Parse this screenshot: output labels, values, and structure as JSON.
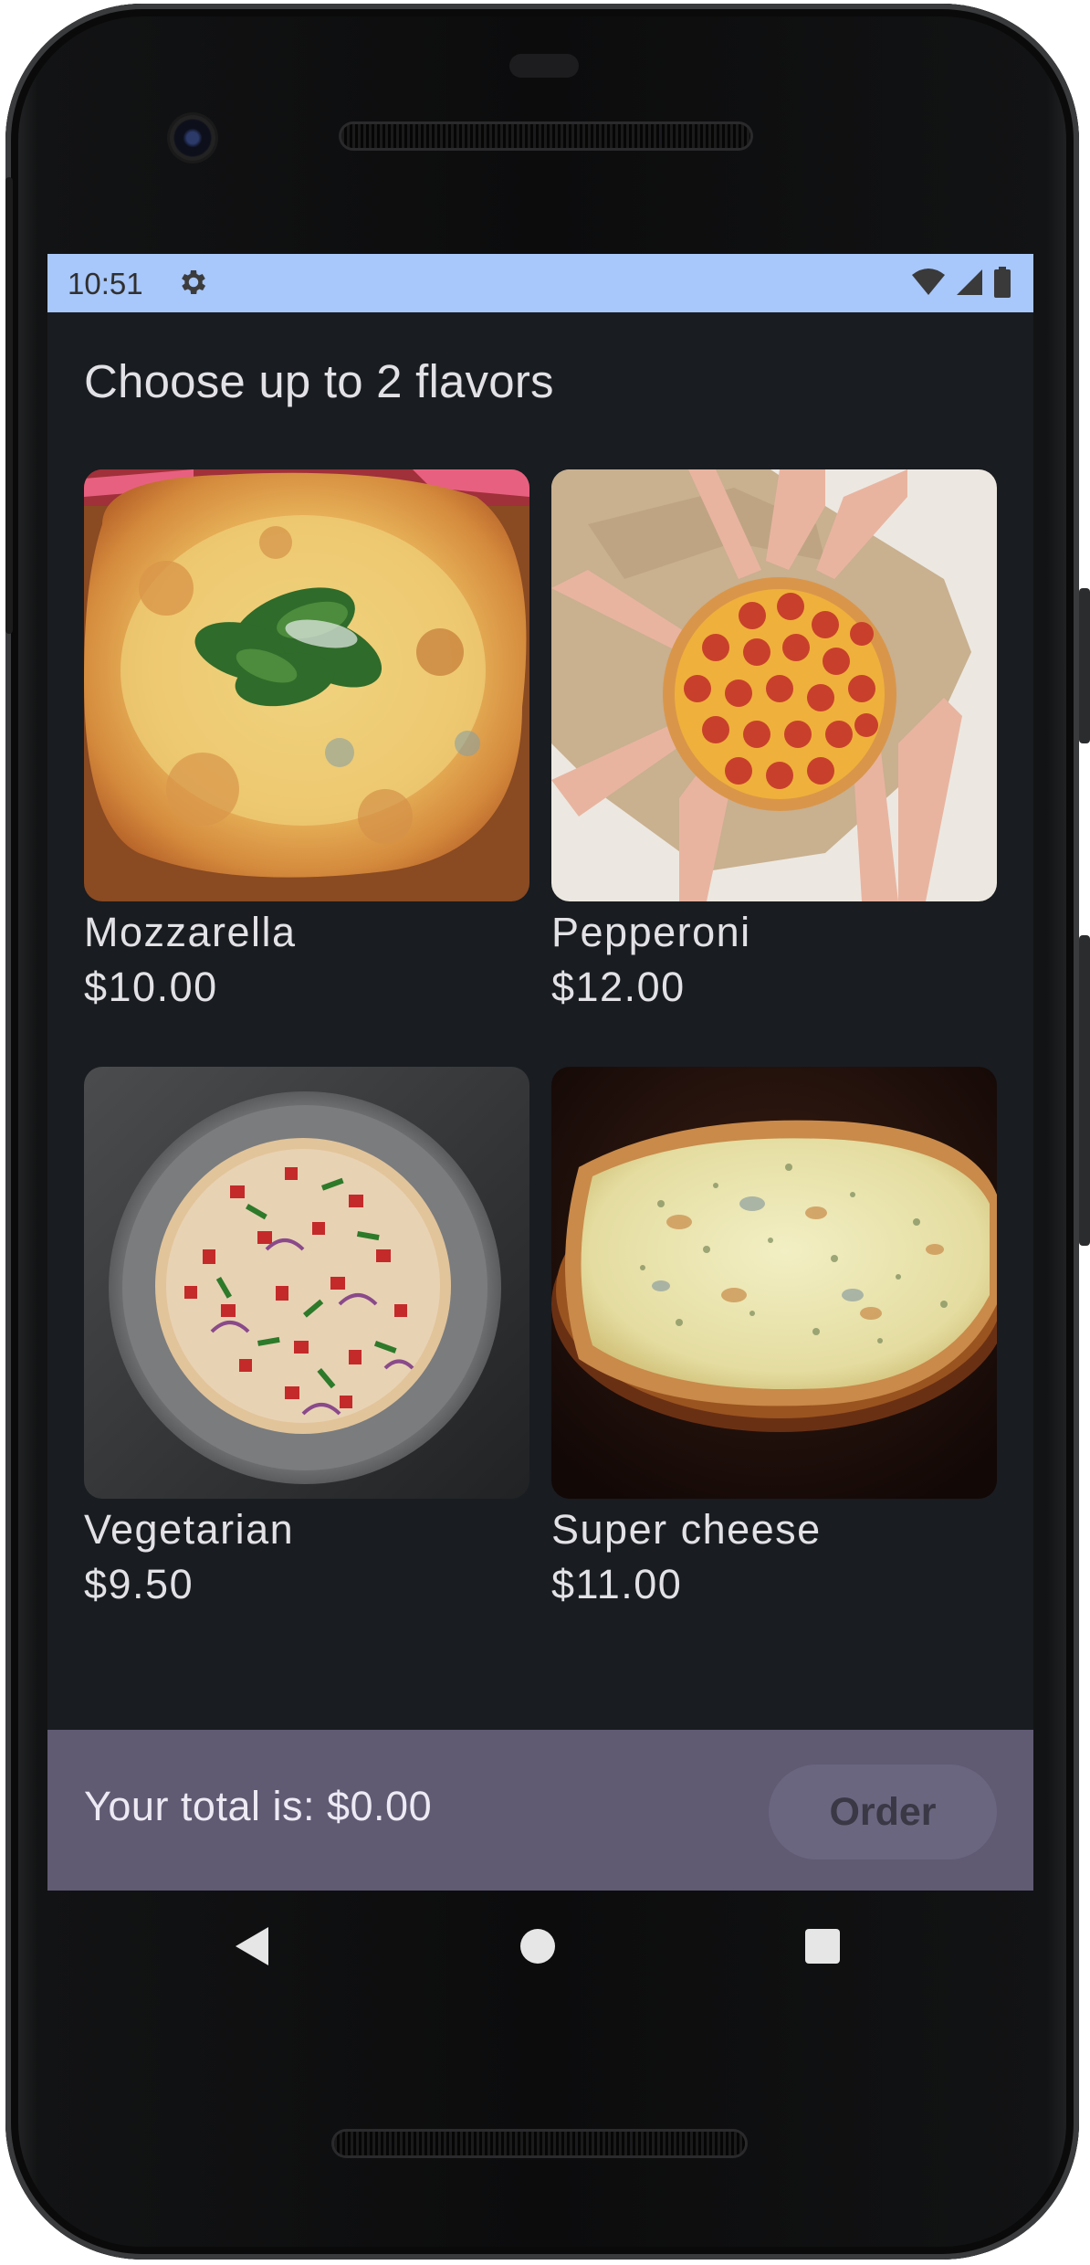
{
  "status_bar": {
    "time": "10:51",
    "icons": [
      "gear-icon",
      "wifi-icon",
      "signal-icon",
      "battery-icon"
    ]
  },
  "page": {
    "title": "Choose up to 2 flavors"
  },
  "flavors": [
    {
      "name": "Mozzarella",
      "price": "$10.00",
      "image": "mozzarella-pizza-photo"
    },
    {
      "name": "Pepperoni",
      "price": "$12.00",
      "image": "pepperoni-pizza-photo"
    },
    {
      "name": "Vegetarian",
      "price": "$9.50",
      "image": "vegetarian-pizza-photo"
    },
    {
      "name": "Super cheese",
      "price": "$11.00",
      "image": "super-cheese-pizza-photo"
    }
  ],
  "footer": {
    "total_label": "Your total is: $0.00",
    "order_label": "Order",
    "order_enabled": false
  },
  "nav_bar": {
    "icons": [
      "back-icon",
      "home-icon",
      "recents-icon"
    ]
  },
  "colors": {
    "status_bar": "#a8c7fa",
    "background": "#191c20",
    "bottom_bar": "#605a73",
    "order_button": "#6b6680"
  }
}
